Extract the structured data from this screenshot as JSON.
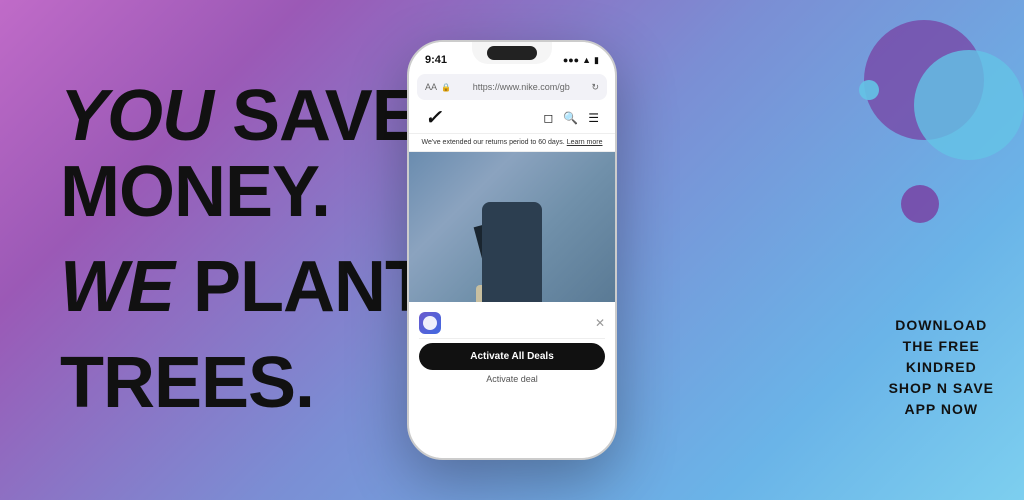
{
  "background": {
    "gradient_start": "#c06bc8",
    "gradient_end": "#7dcfef"
  },
  "left_headline": {
    "line1_italic": "YOU",
    "line1_rest": " SAVE",
    "line2": "MONEY.",
    "line3_italic": "WE",
    "line3_rest": " PLANT",
    "line4": "TREES."
  },
  "phone": {
    "status_time": "9:41",
    "status_signal": "●●●",
    "status_wifi": "wifi",
    "status_battery": "battery",
    "address_aa": "AA",
    "address_url": "https://www.nike.com/gb",
    "banner_text": "We've extended our returns period to 60 days.",
    "banner_link": "Learn more",
    "activate_btn_label": "Activate All Deals",
    "activate_deal_label": "Activate deal"
  },
  "right_cta": {
    "line1": "DOWNLOAD",
    "line2": "THE FREE",
    "line3": "KINDRED",
    "line4": "SHOP N SAVE",
    "line5": "APP NOW"
  },
  "circles": {
    "large_color": "rgba(120,60,160,0.7)",
    "medium_color": "rgba(100,195,230,0.8)",
    "small_top_color": "rgba(100,195,230,0.9)",
    "small_bottom_color": "rgba(120,60,160,0.8)"
  }
}
